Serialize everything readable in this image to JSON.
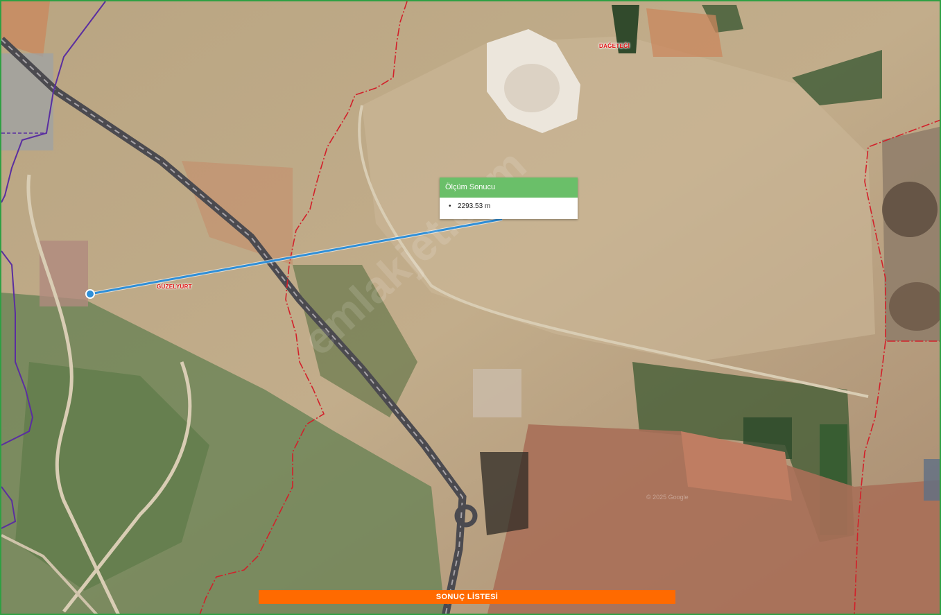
{
  "map": {
    "place_labels": [
      "DAĞETEĞİ",
      "GÜZELYURT"
    ],
    "watermark_text": "emlakjet.com",
    "copyright_text": "© 2025 Google"
  },
  "measurement_popup": {
    "title": "Ölçüm Sonucu",
    "value": "2293.53 m"
  },
  "result_bar": {
    "label": "SONUÇ LİSTESİ"
  },
  "colors": {
    "measure_line": "#2f8fd8",
    "boundary_red": "#d2202a",
    "boundary_purple": "#5a2ea0",
    "popup_header": "#6abf69",
    "result_bar": "#ff6a00"
  }
}
